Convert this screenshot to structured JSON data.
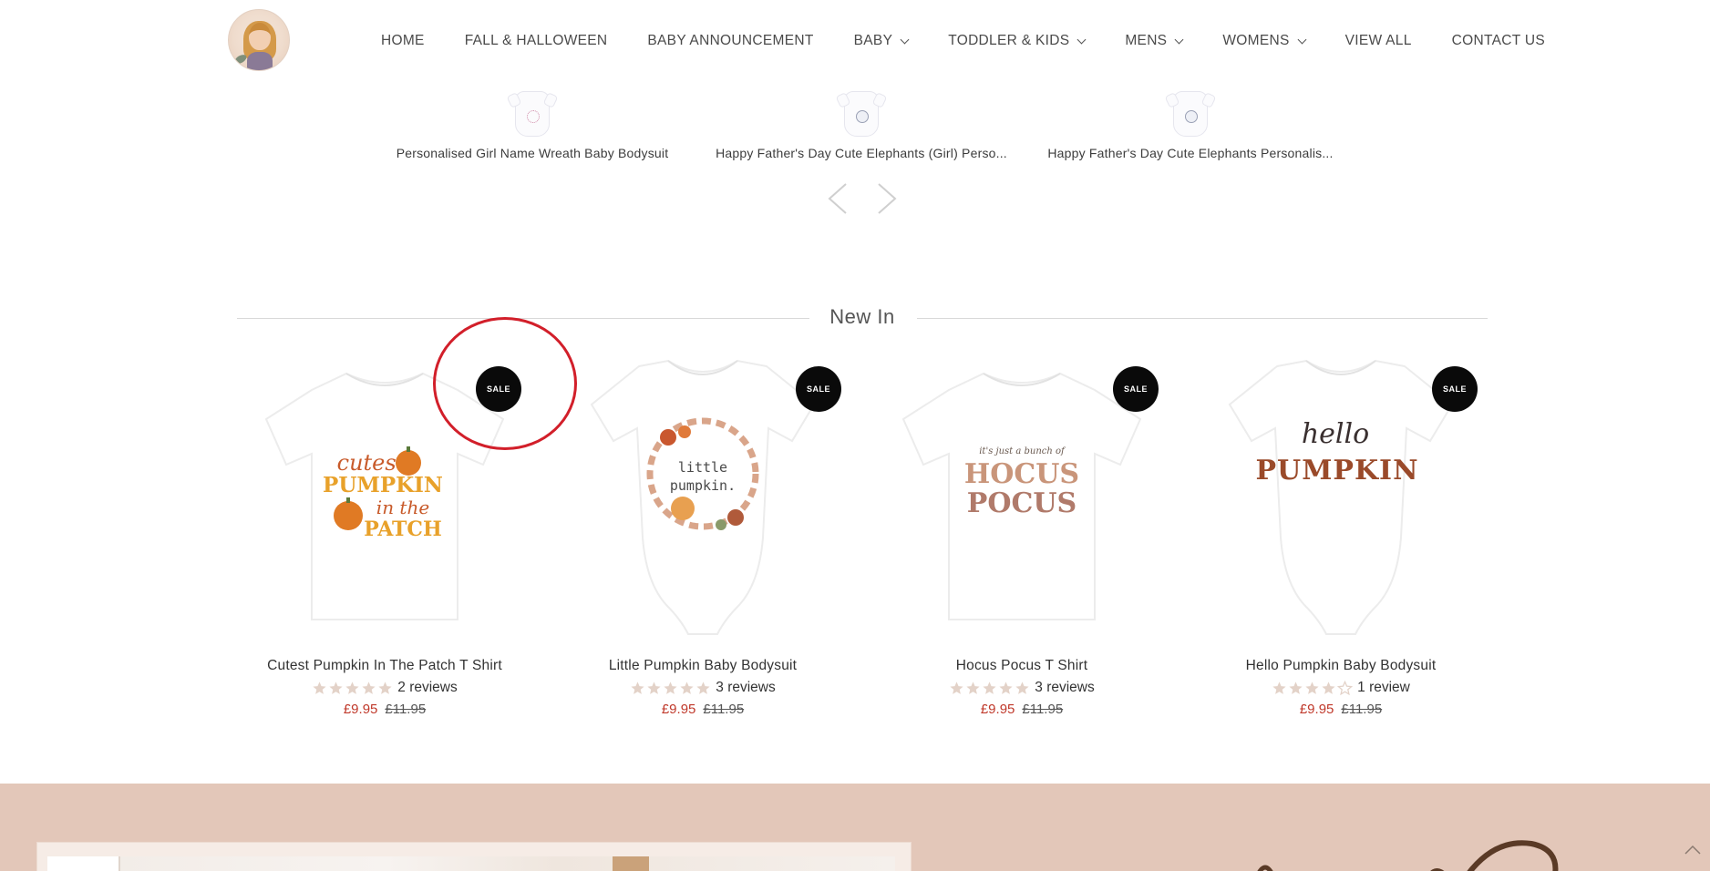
{
  "header": {
    "nav": [
      {
        "label": "HOME",
        "dropdown": false
      },
      {
        "label": "FALL & HALLOWEEN",
        "dropdown": false
      },
      {
        "label": "BABY ANNOUNCEMENT",
        "dropdown": false
      },
      {
        "label": "BABY",
        "dropdown": true
      },
      {
        "label": "TODDLER & KIDS",
        "dropdown": true
      },
      {
        "label": "MENS",
        "dropdown": true
      },
      {
        "label": "WOMENS",
        "dropdown": true
      },
      {
        "label": "VIEW ALL",
        "dropdown": false
      },
      {
        "label": "CONTACT US",
        "dropdown": false
      }
    ]
  },
  "recently_viewed": [
    {
      "title": "Personalised Girl Name Wreath Baby Bodysuit"
    },
    {
      "title": "Happy Father's Day Cute Elephants (Girl) Perso..."
    },
    {
      "title": "Happy Father's Day Cute Elephants Personalis..."
    }
  ],
  "new_in": {
    "heading": "New In",
    "products": [
      {
        "title": "Cutest Pumpkin In The Patch T Shirt",
        "badge": "SALE",
        "rating": 5,
        "reviews": "2 reviews",
        "price": "£9.95",
        "was": "£11.95",
        "print_lines": [
          "cutest",
          "PUMPKIN",
          "in the",
          "PATCH"
        ]
      },
      {
        "title": "Little Pumpkin Baby Bodysuit",
        "badge": "SALE",
        "rating": 5,
        "reviews": "3 reviews",
        "price": "£9.95",
        "was": "£11.95",
        "print_lines": [
          "little",
          "pumpkin."
        ]
      },
      {
        "title": "Hocus Pocus T Shirt",
        "badge": "SALE",
        "rating": 5,
        "reviews": "3 reviews",
        "price": "£9.95",
        "was": "£11.95",
        "print_lines": [
          "it's just a bunch of",
          "HOCUS",
          "POCUS"
        ]
      },
      {
        "title": "Hello Pumpkin Baby Bodysuit",
        "badge": "SALE",
        "rating": 4,
        "reviews": "1 review",
        "price": "£9.95",
        "was": "£11.95",
        "print_lines": [
          "hello",
          "PUMPKIN"
        ]
      }
    ]
  },
  "colors": {
    "sale_price": "#c0392b",
    "badge": "#0a0a0a",
    "star": "#e3d2c8",
    "banner": "#e3c7b9",
    "annotation": "#d21f2a"
  }
}
